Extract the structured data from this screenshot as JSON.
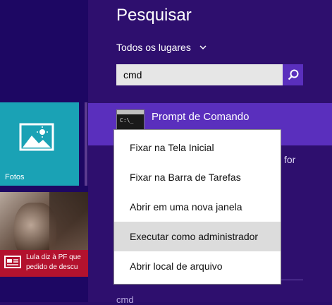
{
  "start": {
    "fotos_tile_label": "Fotos",
    "news_tile_text": [
      "Lula diz à PF que",
      "pedido de descu"
    ],
    "colors": {
      "fotos_tile": "#1aa2b5",
      "news_bar": "#b3122e",
      "start_bg": "#1d0763"
    }
  },
  "search_panel": {
    "title": "Pesquisar",
    "scope_label": "Todos os lugares",
    "scope_icon": "chevron-down-icon",
    "search_value": "cmd",
    "search_icon": "search-icon",
    "accent": "#5a2fbd",
    "result": {
      "label": "Prompt de Comando",
      "icon": "cmd-app-icon"
    },
    "background_text_for": "for",
    "background_text_cmd": "cmd"
  },
  "context_menu": {
    "items": [
      "Fixar na Tela Inicial",
      "Fixar na Barra de Tarefas",
      "Abrir em uma nova janela",
      "Executar como administrador",
      "Abrir local de arquivo"
    ],
    "highlighted_item": "Executar como administrador"
  }
}
